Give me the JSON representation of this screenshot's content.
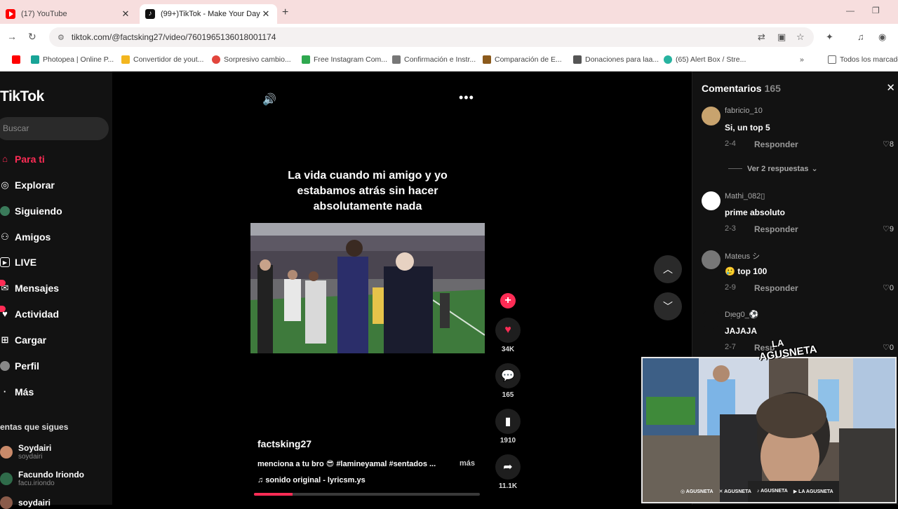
{
  "browser": {
    "tabs": [
      {
        "label": "(17) YouTube",
        "icon": "youtube-icon"
      },
      {
        "label": "(99+)TikTok - Make Your Day",
        "icon": "tiktok-icon"
      }
    ],
    "url": "tiktok.com/@factsking27/video/7601965136018001174",
    "bookmarks": [
      {
        "label": "",
        "color": "#ff0000"
      },
      {
        "label": "Photopea | Online P...",
        "color": "#18a497"
      },
      {
        "label": "Convertidor de yout...",
        "color": "#f3b61f"
      },
      {
        "label": "Sorpresivo cambio...",
        "color": "#e2453c"
      },
      {
        "label": "Free Instagram Com...",
        "color": "#2fa84f"
      },
      {
        "label": "Confirmación e Instr...",
        "color": "#777777"
      },
      {
        "label": "Comparación de E...",
        "color": "#8b5a1c"
      },
      {
        "label": "Donaciones para laa...",
        "color": "#555555"
      },
      {
        "label": "(65) Alert Box / Stre...",
        "color": "#27b3a0"
      }
    ],
    "bookmarks_all": "Todos los marcado"
  },
  "tiktok": {
    "logo": "TikTok",
    "search_placeholder": "Buscar",
    "nav": [
      {
        "label": "Para ti",
        "icon": "home-icon",
        "active": true
      },
      {
        "label": "Explorar",
        "icon": "compass-icon"
      },
      {
        "label": "Siguiendo",
        "icon": "following-icon"
      },
      {
        "label": "Amigos",
        "icon": "friends-icon"
      },
      {
        "label": "LIVE",
        "icon": "live-icon"
      },
      {
        "label": "Mensajes",
        "icon": "messages-icon"
      },
      {
        "label": "Actividad",
        "icon": "activity-icon"
      },
      {
        "label": "Cargar",
        "icon": "upload-icon"
      },
      {
        "label": "Perfil",
        "icon": "profile-icon"
      },
      {
        "label": "Más",
        "icon": "more-icon"
      }
    ],
    "following_title": "entas que sigues",
    "following": [
      {
        "name": "Soydairi",
        "handle": "soydairi",
        "color": "#c98a6a"
      },
      {
        "name": "Facundo Iriondo",
        "handle": "facu.iriondo",
        "color": "#2f6b4a"
      },
      {
        "name": "soydairi",
        "handle": "",
        "color": "#8a5b4a"
      }
    ],
    "video": {
      "caption_overlay": "La vida cuando mi amigo y yo estabamos atrás sin hacer absolutamente nada",
      "author": "factsking27",
      "description": "menciona a tu bro 😎 #lamineyamal #sentados ...",
      "more": "más",
      "music": "sonido original - lyricsm.ys",
      "progress": 0.17
    },
    "actions": {
      "likes": "34K",
      "comments": "165",
      "saves": "1910",
      "shares": "11.1K"
    },
    "comments_panel": {
      "title": "Comentarios",
      "count": "165",
      "view_replies": "Ver 2 respuestas",
      "items": [
        {
          "user": "fabricio_10",
          "text": "Si, un top 5",
          "date": "2-4",
          "reply": "Responder",
          "likes": "8",
          "color": "#c8a36e"
        },
        {
          "user": "Mathi_082▯",
          "text": "prime absoluto",
          "date": "2-3",
          "reply": "Responder",
          "likes": "9",
          "color": "#ffffff"
        },
        {
          "user": "Mateus シ",
          "text": "🥲 top 100",
          "date": "2-9",
          "reply": "Responder",
          "likes": "0",
          "color": "#777777"
        },
        {
          "user": "Dᴉeg0_⚽",
          "text": "JAJAJA",
          "date": "2-7",
          "reply": "Resp",
          "likes": "0",
          "color": "#121212"
        }
      ]
    }
  },
  "webcam": {
    "logo_top": "LA",
    "logo_bottom": "AGUSNETA",
    "socials": [
      "AGUSNETA",
      "AGUSNETA",
      "AGUSNETA",
      "LA AGUSNETA"
    ]
  }
}
